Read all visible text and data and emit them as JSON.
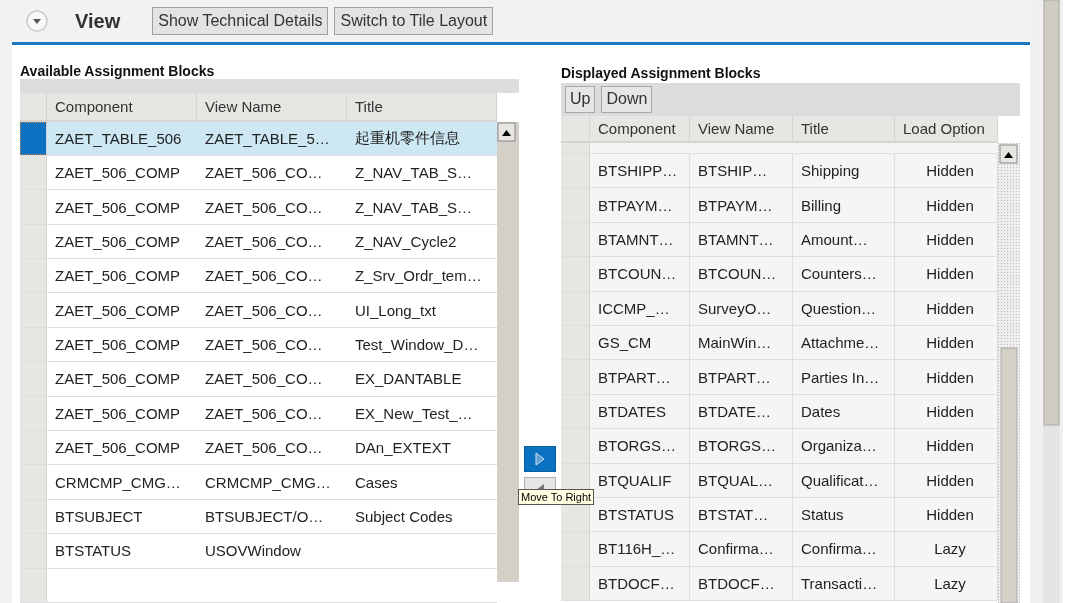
{
  "header": {
    "title": "View",
    "buttons": [
      "Show Technical Details",
      "Switch to Tile Layout"
    ]
  },
  "available": {
    "title": "Available Assignment Blocks",
    "columns": [
      "Component",
      "View Name",
      "Title"
    ],
    "rows": [
      {
        "cells": [
          "ZAET_TABLE_506",
          "ZAET_TABLE_5…",
          "起重机零件信息"
        ],
        "selected": true
      },
      {
        "cells": [
          "ZAET_506_COMP",
          "ZAET_506_CO…",
          "Z_NAV_TAB_S…"
        ],
        "selected": false
      },
      {
        "cells": [
          "ZAET_506_COMP",
          "ZAET_506_CO…",
          "Z_NAV_TAB_S…"
        ],
        "selected": false
      },
      {
        "cells": [
          "ZAET_506_COMP",
          "ZAET_506_CO…",
          "Z_NAV_Cycle2"
        ],
        "selected": false
      },
      {
        "cells": [
          "ZAET_506_COMP",
          "ZAET_506_CO…",
          "Z_Srv_Ordr_tem…"
        ],
        "selected": false
      },
      {
        "cells": [
          "ZAET_506_COMP",
          "ZAET_506_CO…",
          "UI_Long_txt"
        ],
        "selected": false
      },
      {
        "cells": [
          "ZAET_506_COMP",
          "ZAET_506_CO…",
          "Test_Window_D…"
        ],
        "selected": false
      },
      {
        "cells": [
          "ZAET_506_COMP",
          "ZAET_506_CO…",
          "EX_DANTABLE"
        ],
        "selected": false
      },
      {
        "cells": [
          "ZAET_506_COMP",
          "ZAET_506_CO…",
          "EX_New_Test_…"
        ],
        "selected": false
      },
      {
        "cells": [
          "ZAET_506_COMP",
          "ZAET_506_CO…",
          "DAn_EXTEXT"
        ],
        "selected": false
      },
      {
        "cells": [
          "CRMCMP_CMG…",
          "CRMCMP_CMG…",
          "Cases"
        ],
        "selected": false
      },
      {
        "cells": [
          "BTSUBJECT",
          "BTSUBJECT/O…",
          "Subject Codes"
        ],
        "selected": false
      },
      {
        "cells": [
          "BTSTATUS",
          "USOVWindow",
          ""
        ],
        "selected": false
      },
      {
        "cells": [
          "",
          "",
          ""
        ],
        "selected": false
      }
    ]
  },
  "move_buttons": {
    "tooltip": "Move To Right"
  },
  "displayed": {
    "title": "Displayed Assignment Blocks",
    "buttons": [
      "Up",
      "Down"
    ],
    "columns": [
      "Component",
      "View Name",
      "Title",
      "Load Option"
    ],
    "rows": [
      {
        "cells": [
          "BTSHIPP…",
          "BTSHIP…",
          "Shipping",
          "Hidden"
        ],
        "selected": false
      },
      {
        "cells": [
          "BTPAYM…",
          "BTPAYM…",
          "Billing",
          "Hidden"
        ],
        "selected": false
      },
      {
        "cells": [
          "BTAMNT…",
          "BTAMNT…",
          "Amount…",
          "Hidden"
        ],
        "selected": false
      },
      {
        "cells": [
          "BTCOUN…",
          "BTCOUN…",
          "Counters…",
          "Hidden"
        ],
        "selected": false
      },
      {
        "cells": [
          "ICCMP_…",
          "SurveyO…",
          "Question…",
          "Hidden"
        ],
        "selected": false
      },
      {
        "cells": [
          "GS_CM",
          "MainWin…",
          "Attachme…",
          "Hidden"
        ],
        "selected": false
      },
      {
        "cells": [
          "BTPART…",
          "BTPART…",
          "Parties In…",
          "Hidden"
        ],
        "selected": false
      },
      {
        "cells": [
          "BTDATES",
          "BTDATE…",
          "Dates",
          "Hidden"
        ],
        "selected": false
      },
      {
        "cells": [
          "BTORGS…",
          "BTORGS…",
          "Organiza…",
          "Hidden"
        ],
        "selected": false
      },
      {
        "cells": [
          "BTQUALIF",
          "BTQUAL…",
          "Qualificat…",
          "Hidden"
        ],
        "selected": false
      },
      {
        "cells": [
          "BTSTATUS",
          "BTSTAT…",
          "Status",
          "Hidden"
        ],
        "selected": false
      },
      {
        "cells": [
          "BT116H_…",
          "Confirma…",
          "Confirma…",
          "Lazy"
        ],
        "selected": false
      },
      {
        "cells": [
          "BTDOCF…",
          "BTDOCF…",
          "Transacti…",
          "Lazy"
        ],
        "selected": false
      }
    ]
  }
}
